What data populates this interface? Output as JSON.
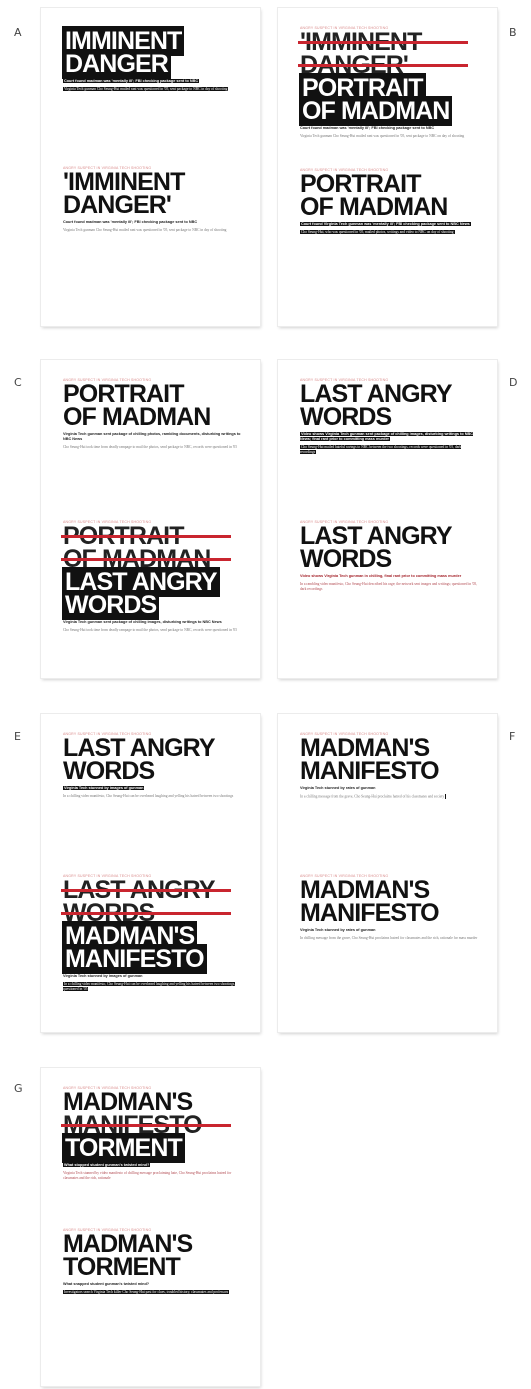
{
  "panels": [
    {
      "letter": "A",
      "top": {
        "kicker": "ANGRY SUSPECT IN VIRGINIA TECH SHOOTING",
        "headline": [
          "IMMINENT",
          "DANGER"
        ],
        "dek": "Court found madman was 'mentally ill'; FBI checking package sent to NBC",
        "body": "Virginia Tech gunman Cho Seung-Hui mailed rant was questioned in '05, sent package to NBC in day of shooting"
      },
      "bottom": {
        "kicker": "ANGRY SUSPECT IN VIRGINIA TECH SHOOTING",
        "headline": [
          "'IMMINENT",
          "DANGER'"
        ],
        "dek": "Court found madman was 'mentally ill'; FBI checking package sent to NBC",
        "body": "Virginia Tech gunman Cho Seung-Hui mailed rant was questioned in '05, sent package to NBC in day of shooting"
      }
    },
    {
      "letter": "B",
      "top": {
        "kicker": "ANGRY SUSPECT IN VIRGINIA TECH SHOOTING",
        "struck": [
          "'IMMINENT",
          "DANGER'"
        ],
        "headline": [
          "PORTRAIT",
          "OF MADMAN"
        ],
        "dek": "Court found madman was 'mentally ill'; FBI checking package sent to NBC",
        "body": "Virginia Tech gunman Cho Seung-Hui mailed rant was questioned in '05, sent package to NBC on day of shooting"
      },
      "bottom": {
        "kicker": "ANGRY SUSPECT IN VIRGINIA TECH SHOOTING",
        "headline": [
          "PORTRAIT",
          "OF MADMAN"
        ],
        "dek": "Court found Virginia Tech gunman was 'mentally ill'; FBI checking package sent to NBC News",
        "body": "Cho Seung-Hui, who was questioned in '05, mailed photos, writings and video to NBC on day of shooting"
      }
    },
    {
      "letter": "C",
      "top": {
        "kicker": "ANGRY SUSPECT IN VIRGINIA TECH SHOOTING",
        "headline": [
          "PORTRAIT",
          "OF MADMAN"
        ],
        "dek": "Virginia Tech gunman sent package of chilling photos, rambling documents, disturbing writings to NBC News",
        "body": "Cho Seung-Hui took time from deadly rampage to mail the photos, send package to NBC, records were questioned in '05"
      },
      "bottom": {
        "kicker": "ANGRY SUSPECT IN VIRGINIA TECH SHOOTING",
        "struck": [
          "PORTRAIT",
          "OF MADMAN"
        ],
        "headline": [
          "LAST ANGRY",
          "WORDS"
        ],
        "dek": "Virginia Tech gunman sent package of chilling images, disturbing writings to NBC News",
        "body": "Cho Seung-Hui took time from deadly rampage to mail the photos, send package to NBC, records were questioned in '05"
      }
    },
    {
      "letter": "D",
      "top": {
        "kicker": "ANGRY SUSPECT IN VIRGINIA TECH SHOOTING",
        "headline": [
          "LAST ANGRY",
          "WORDS"
        ],
        "dek": "Video shows Virginia Tech gunman sent package of chilling images, disturbing writings to NBC News; final rant prior to committing mass murder",
        "body": "Cho Seung-Hui mailed hateful ravings to NBC between the two shootings, records were questioned in '05, dark recordings"
      },
      "bottom": {
        "kicker": "ANGRY SUSPECT IN VIRGINIA TECH SHOOTING",
        "headline": [
          "LAST ANGRY",
          "WORDS"
        ],
        "dek": "Video shows Virginia Tech gunman in chilling, final rant prior to committing mass murder",
        "body": "In a rambling video manifesto, Cho Seung-Hui described his rage; the network sent images and writings; questioned in '05, dark recordings"
      }
    },
    {
      "letter": "E",
      "top": {
        "kicker": "ANGRY SUSPECT IN VIRGINIA TECH SHOOTING",
        "headline": [
          "LAST ANGRY",
          "WORDS"
        ],
        "dek": "Virginia Tech stunned by images of gunman",
        "body": "In a chilling video manifesto, Cho Seung-Hui can be overheard laughing and yelling his hatred between two shootings"
      },
      "bottom": {
        "kicker": "ANGRY SUSPECT IN VIRGINIA TECH SHOOTING",
        "struck": [
          "LAST ANGRY",
          "WORDS"
        ],
        "headline": [
          "MADMAN'S",
          "MANIFESTO"
        ],
        "dek": "Virginia Tech stunned by images of gunman",
        "body": "In a chilling video manifesto, Cho Seung-Hui can be overheard laughing and yelling his hatred between two shootings, questioned in '05"
      }
    },
    {
      "letter": "F",
      "top": {
        "kicker": "ANGRY SUSPECT IN VIRGINIA TECH SHOOTING",
        "headline": [
          "MADMAN'S",
          "MANIFESTO"
        ],
        "dek": "Virginia Tech stunned by rates of gunman",
        "body": "In a chilling message from the grave, Cho Seung-Hui proclaims hatred of his classmates and society"
      },
      "bottom": {
        "kicker": "ANGRY SUSPECT IN VIRGINIA TECH SHOOTING",
        "headline": [
          "MADMAN'S",
          "MANIFESTO"
        ],
        "dek": "Virginia Tech stunned by rates of gunman",
        "body": "In chilling message from the grave, Cho Seung-Hui proclaims hatred for classmates and the rich, rationale for mass murder"
      }
    },
    {
      "letter": "G",
      "top": {
        "kicker": "ANGRY SUSPECT IN VIRGINIA TECH SHOOTING",
        "headline_a": "MADMAN'S",
        "struck_line": "MANIFESTO",
        "headline_b": "TORMENT",
        "dek": "What stopped student gunman's twisted mind?",
        "body": "Virginia Tech stunned by video manifesto of chilling message proclaiming hate, Cho Seung-Hui proclaims hatred for classmates and the rich, rationale"
      },
      "bottom": {
        "kicker": "ANGRY SUSPECT IN VIRGINIA TECH SHOOTING",
        "headline": [
          "MADMAN'S",
          "TORMENT"
        ],
        "dek": "What snapped student gunman's twisted mind?",
        "body": "Investigators search Virginia Tech killer Cho Seung-Hui past for clues, troubled history, classmates and professors"
      }
    }
  ]
}
